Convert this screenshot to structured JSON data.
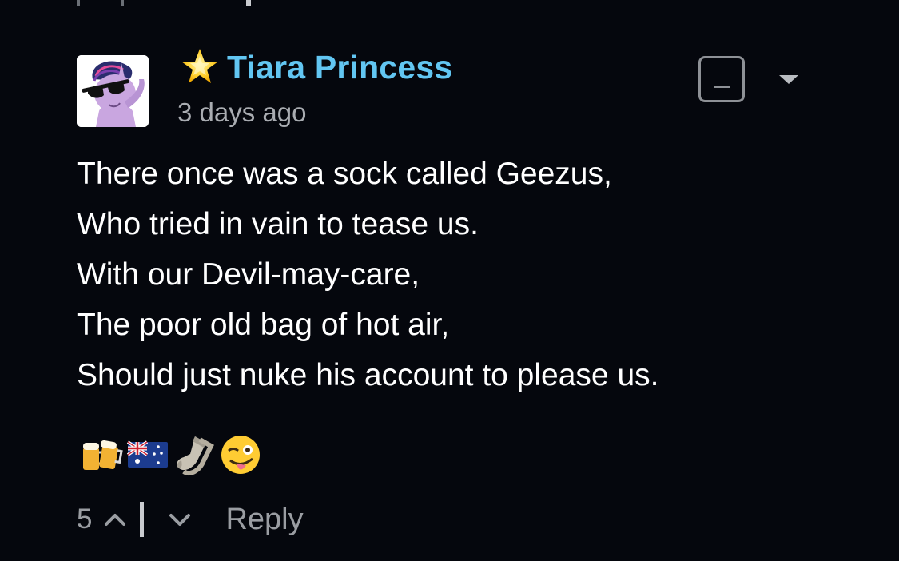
{
  "comment": {
    "author": "Tiara Princess",
    "timestamp": "3 days ago",
    "badge_icon": "star-icon",
    "avatar_icon": "pony-with-sunglasses-icon",
    "body_lines": [
      "There once was a sock called Geezus,",
      "Who tried in vain to tease us.",
      "With our Devil-may-care,",
      "The poor old bag of hot air,",
      "Should just nuke his account to please us."
    ],
    "reactions": [
      "beer-mugs-icon",
      "australia-flag-icon",
      "sock-icon",
      "winking-tongue-face-icon"
    ],
    "votes": "5",
    "reply_label": "Reply"
  },
  "colors": {
    "background": "#05070d",
    "username": "#62c6f2",
    "muted": "#9a9da2",
    "star": "#f5c518"
  }
}
